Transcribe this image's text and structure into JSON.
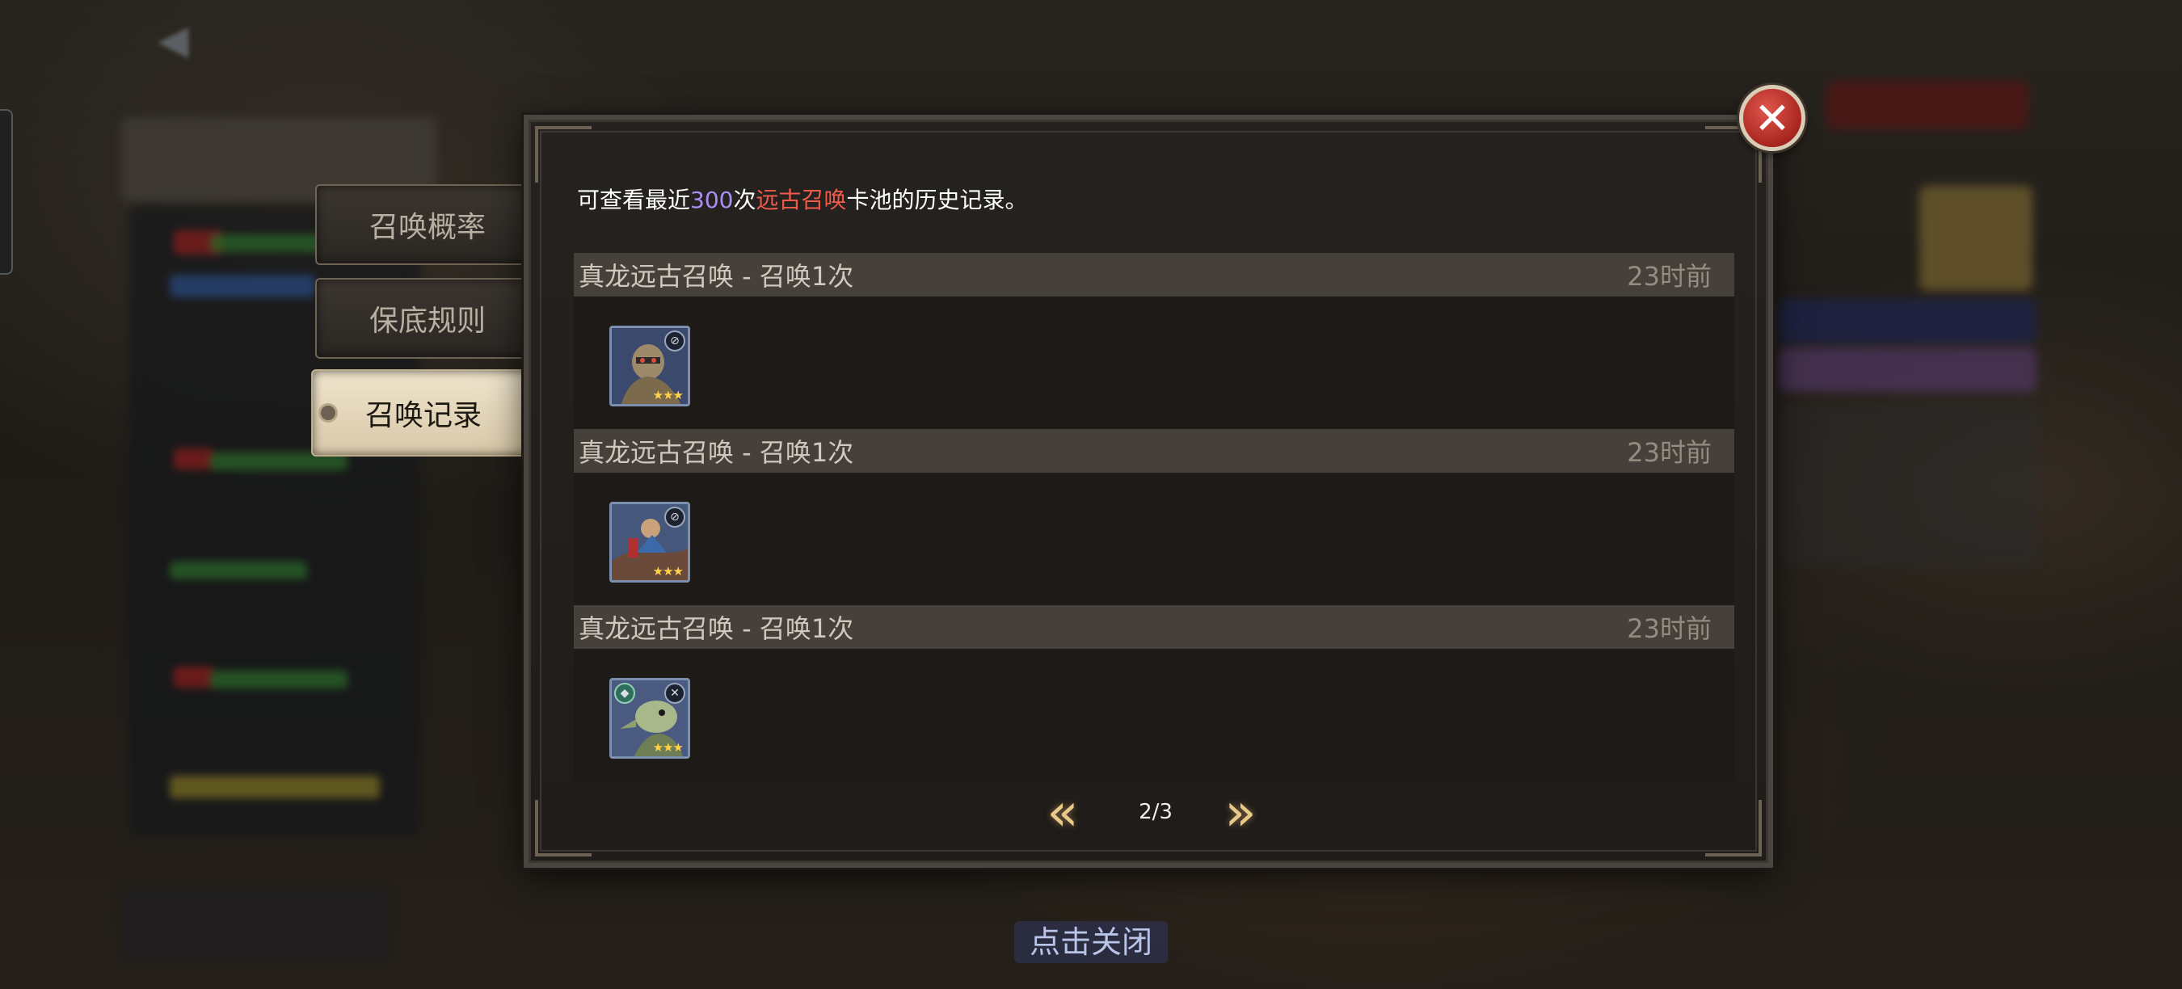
{
  "tabs": [
    {
      "label": "召唤概率",
      "active": false
    },
    {
      "label": "保底规则",
      "active": false
    },
    {
      "label": "召唤记录",
      "active": true
    }
  ],
  "description": {
    "prefix": "可查看最近",
    "count": "300",
    "middle": "次",
    "pool_name": "远古召唤",
    "suffix": "卡池的历史记录。",
    "count_color": "#a98ef5",
    "pool_color": "#f05a4a"
  },
  "records": [
    {
      "title": "真龙远古召唤 - 召唤1次",
      "time": "23时前",
      "hero": {
        "icon": "armored-warrior-portrait",
        "stars": "★★★",
        "class_icon": "no-weapon-icon"
      }
    },
    {
      "title": "真龙远古召唤 - 召唤1次",
      "time": "23时前",
      "hero": {
        "icon": "rider-portrait",
        "stars": "★★★",
        "class_icon": "no-weapon-icon"
      }
    },
    {
      "title": "真龙远古召唤 - 召唤1次",
      "time": "23时前",
      "hero": {
        "icon": "lizard-portrait",
        "stars": "★★★",
        "class_icon": "crossbow-icon"
      }
    }
  ],
  "pagination": {
    "current": "2/3",
    "prev_icon": "double-chevron-left-icon",
    "next_icon": "double-chevron-right-icon"
  },
  "close_icon": "close-x-icon",
  "tap_to_close": "点击关闭"
}
